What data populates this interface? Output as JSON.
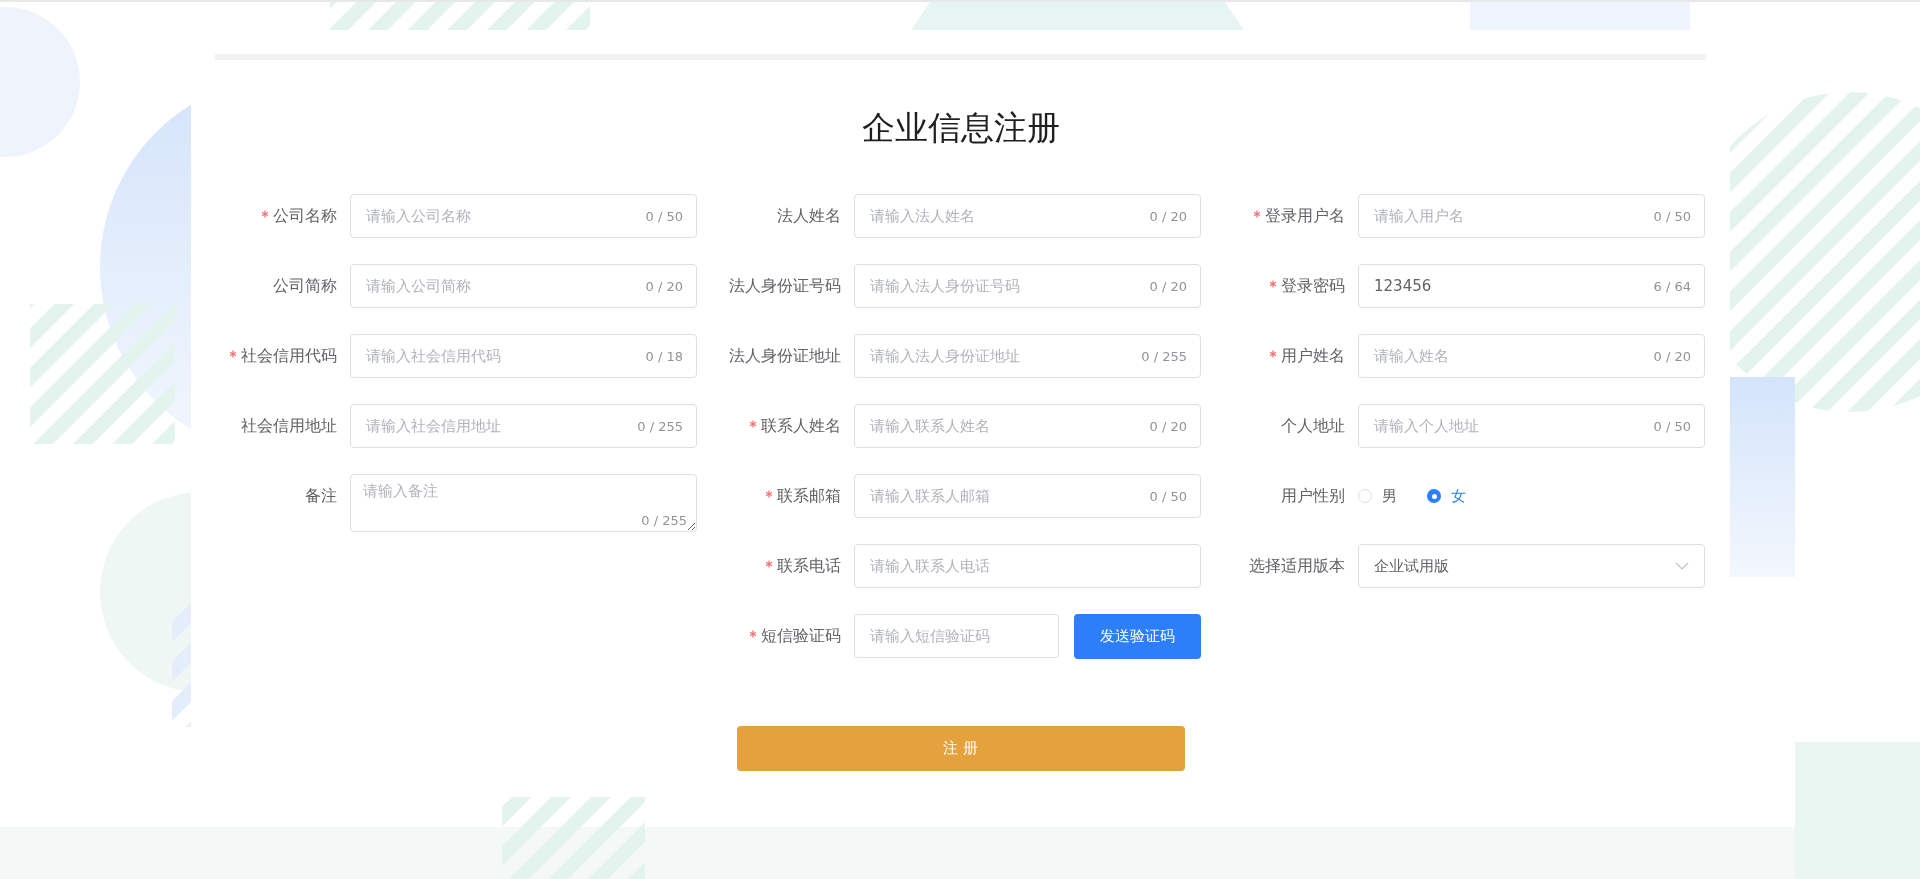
{
  "title": "企业信息注册",
  "columns": [
    [
      {
        "kind": "input",
        "label": "公司名称",
        "required": true,
        "placeholder": "请输入公司名称",
        "counter": "0 / 50"
      },
      {
        "kind": "input",
        "label": "公司简称",
        "required": false,
        "placeholder": "请输入公司简称",
        "counter": "0 / 20"
      },
      {
        "kind": "input",
        "label": "社会信用代码",
        "required": true,
        "placeholder": "请输入社会信用代码",
        "counter": "0 / 18"
      },
      {
        "kind": "input",
        "label": "社会信用地址",
        "required": false,
        "placeholder": "请输入社会信用地址",
        "counter": "0 / 255"
      },
      {
        "kind": "textarea",
        "label": "备注",
        "required": false,
        "placeholder": "请输入备注",
        "counter": "0 / 255"
      }
    ],
    [
      {
        "kind": "input",
        "label": "法人姓名",
        "required": false,
        "placeholder": "请输入法人姓名",
        "counter": "0 / 20"
      },
      {
        "kind": "input",
        "label": "法人身份证号码",
        "required": false,
        "placeholder": "请输入法人身份证号码",
        "counter": "0 / 20"
      },
      {
        "kind": "input",
        "label": "法人身份证地址",
        "required": false,
        "placeholder": "请输入法人身份证地址",
        "counter": "0 / 255"
      },
      {
        "kind": "input",
        "label": "联系人姓名",
        "required": true,
        "placeholder": "请输入联系人姓名",
        "counter": "0 / 20"
      },
      {
        "kind": "input",
        "label": "联系邮箱",
        "required": true,
        "placeholder": "请输入联系人邮箱",
        "counter": "0 / 50"
      },
      {
        "kind": "input",
        "label": "联系电话",
        "required": true,
        "placeholder": "请输入联系人电话"
      },
      {
        "kind": "code",
        "label": "短信验证码",
        "required": true,
        "placeholder": "请输入短信验证码",
        "button": "发送验证码"
      }
    ],
    [
      {
        "kind": "input",
        "label": "登录用户名",
        "required": true,
        "placeholder": "请输入用户名",
        "counter": "0 / 50"
      },
      {
        "kind": "input",
        "label": "登录密码",
        "required": true,
        "value": "123456",
        "counter": "6 / 64"
      },
      {
        "kind": "input",
        "label": "用户姓名",
        "required": true,
        "placeholder": "请输入姓名",
        "counter": "0 / 20"
      },
      {
        "kind": "input",
        "label": "个人地址",
        "required": false,
        "placeholder": "请输入个人地址",
        "counter": "0 / 50"
      },
      {
        "kind": "radio",
        "label": "用户性别",
        "required": false,
        "options": [
          {
            "label": "男",
            "selected": false
          },
          {
            "label": "女",
            "selected": true
          }
        ]
      },
      {
        "kind": "select",
        "label": "选择适用版本",
        "required": false,
        "value": "企业试用版"
      }
    ]
  ],
  "submit_button": "注 册"
}
